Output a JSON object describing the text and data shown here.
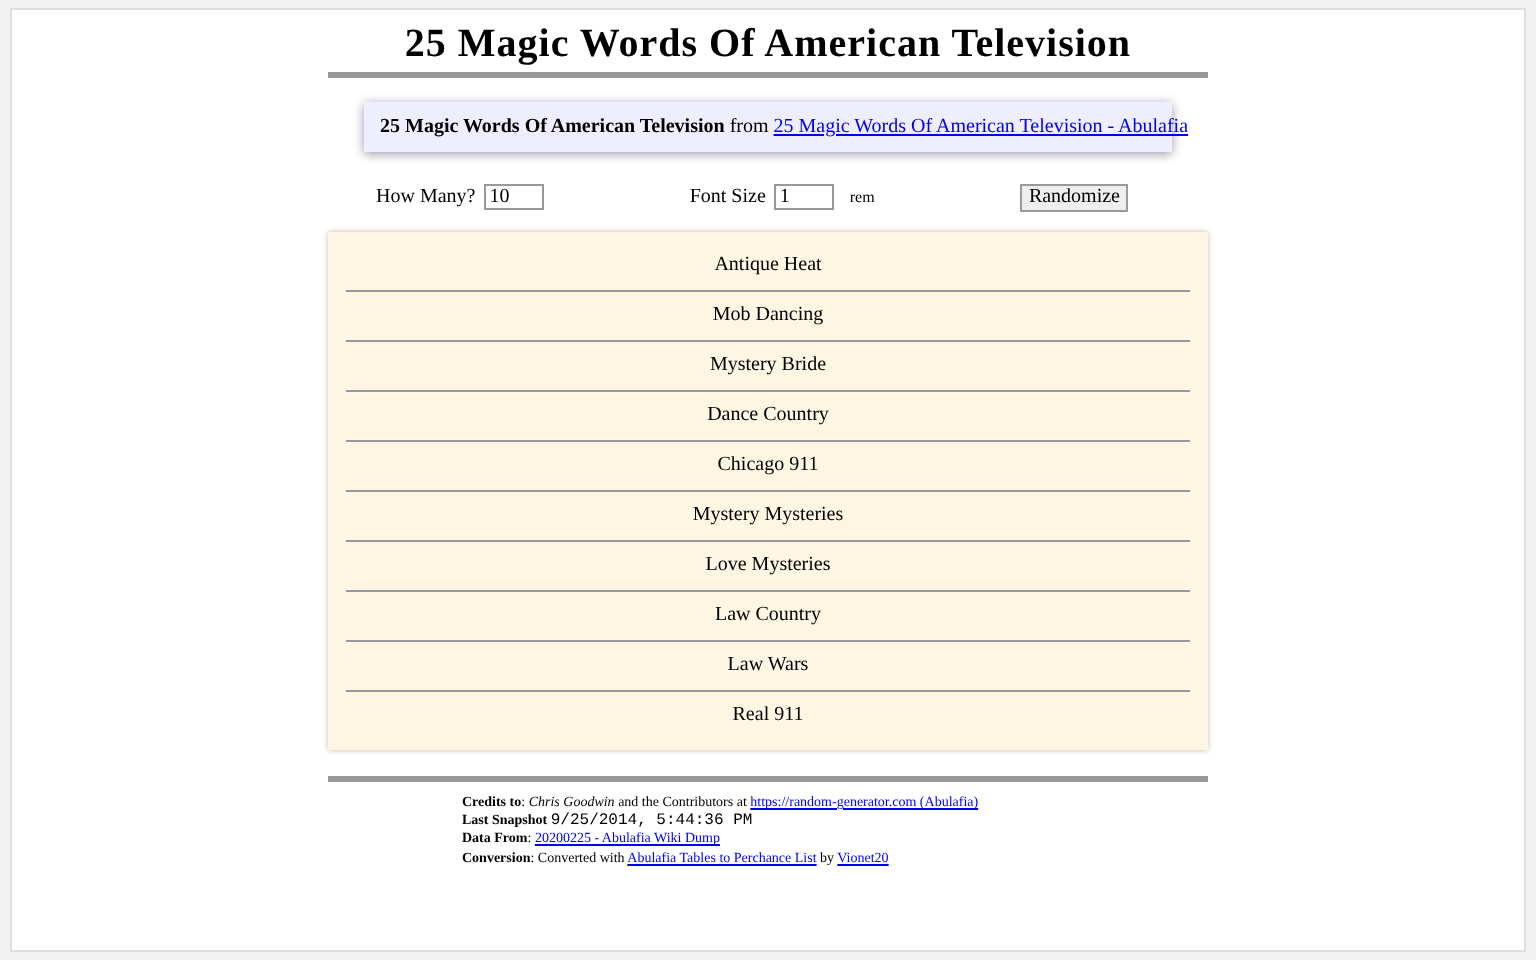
{
  "title": "25 Magic Words Of American Television",
  "source": {
    "name": "25 Magic Words Of American Television",
    "from": "from",
    "link": "25 Magic Words Of American Television - Abulafia"
  },
  "controls": {
    "how_many_label": "How Many?",
    "how_many_value": "10",
    "font_size_label": "Font Size",
    "font_size_value": "1",
    "font_size_unit": "rem",
    "button": "Randomize"
  },
  "results": [
    "Antique Heat",
    "Mob Dancing",
    "Mystery Bride",
    "Dance Country",
    "Chicago 911",
    "Mystery Mysteries",
    "Love Mysteries",
    "Law Country",
    "Law Wars",
    "Real 911"
  ],
  "credits": [
    [
      {
        "kind": "text",
        "text": "**Credits to**: *Chris Goodwin* and the Contributors at "
      },
      {
        "kind": "link",
        "text": "https://random-generator.com (Abulafia)"
      }
    ],
    [
      {
        "kind": "text",
        "text": "**Last Snapshot** "
      },
      {
        "kind": "mono",
        "text": "9/25/2014, 5:44:36 PM"
      }
    ],
    [
      {
        "kind": "text",
        "text": "**Data From**: "
      },
      {
        "kind": "link",
        "text": "20200225 - Abulafia Wiki Dump"
      }
    ],
    [
      {
        "kind": "text",
        "text": "**Conversion**: Converted with "
      },
      {
        "kind": "link",
        "text": "Abulafia Tables to Perchance List"
      },
      {
        "kind": "text",
        "text": " by "
      },
      {
        "kind": "link",
        "text": "Vionet20"
      }
    ]
  ]
}
